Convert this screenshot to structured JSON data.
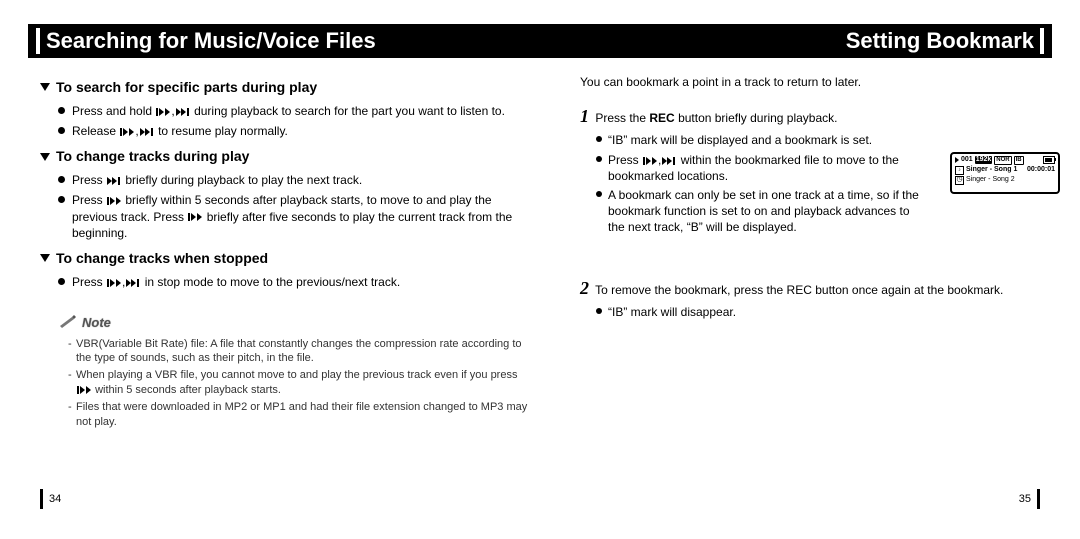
{
  "header": {
    "left_title": "Searching for Music/Voice Files",
    "right_title": "Setting Bookmark"
  },
  "left": {
    "sec1": {
      "title": "To search for specific parts during play",
      "b1_pre": "Press and hold ",
      "b1_post": " during playback to search for the part you want to listen to.",
      "b2_pre": "Release ",
      "b2_post": " to resume play normally."
    },
    "sec2": {
      "title": "To change tracks during play",
      "b1_pre": "Press ",
      "b1_post": " briefly during playback to play the next track.",
      "b2_pre": "Press ",
      "b2_mid": " briefly within 5 seconds after playback starts, to move to and play the previous track. Press ",
      "b2_post": " briefly after five seconds to play the current track from the beginning."
    },
    "sec3": {
      "title": "To change tracks when stopped",
      "b1_pre": "Press ",
      "b1_post": " in stop mode to move to the previous/next track."
    },
    "note": {
      "label": "Note",
      "n1": "VBR(Variable Bit Rate) file: A file that constantly changes the compression rate according to the type of sounds, such as their pitch, in the file.",
      "n2_pre": "When playing a VBR file, you cannot move to and play the previous track even if you press ",
      "n2_post": " within 5 seconds after playback starts.",
      "n3": "Files that were downloaded in MP2 or MP1 and had their file extension changed to MP3 may not play."
    }
  },
  "right": {
    "intro": "You can bookmark a point in a track to return to later.",
    "step1": {
      "text_pre": "Press the ",
      "text_bold": "REC",
      "text_post": " button briefly during playback.",
      "s1": "“IB” mark will be displayed and a bookmark is set.",
      "s2_pre": "Press ",
      "s2_post": " within the bookmarked file to move to the bookmarked locations.",
      "s3": "A bookmark can only be set in one track at a time, so if the bookmark function is set to on and playback advances to the next track, “B” will be displayed."
    },
    "step2": {
      "text": "To remove the bookmark, press the REC button once again at the bookmark.",
      "s1": "“IB” mark will disappear."
    },
    "device": {
      "track_no": "001",
      "bitrate": "192k",
      "ind1": "NOR",
      "ind2": "IB",
      "line1": "Singer - Song 1",
      "time": "00:00:01",
      "line2": "Singer - Song 2"
    }
  },
  "pagenum": {
    "left": "34",
    "right": "35"
  }
}
